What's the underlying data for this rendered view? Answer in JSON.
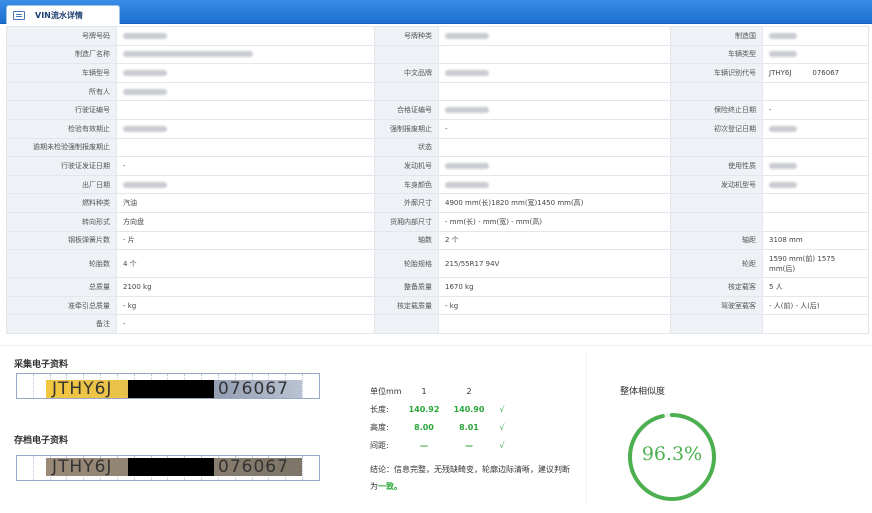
{
  "window": {
    "tab_title": "VIN流水详情",
    "tab_icon": "window-icon"
  },
  "rows": [
    [
      "号牌号码",
      "",
      "号牌种类",
      "",
      "制造国",
      ""
    ],
    [
      "制造厂名称",
      "",
      "",
      "",
      "车辆类型",
      ""
    ],
    [
      "车辆型号",
      "",
      "中文品牌",
      "",
      "车辆识别代号",
      "JTHY6J   076067"
    ],
    [
      "所有人",
      "",
      "",
      "",
      "",
      ""
    ],
    [
      "行驶证编号",
      "",
      "合格证编号",
      "",
      "保险终止日期",
      "-"
    ],
    [
      "检验有效期止",
      "",
      "强制报废期止",
      "-",
      "初次登记日期",
      ""
    ],
    [
      "逾期未检验强制报废期止",
      "",
      "状态",
      "",
      "",
      ""
    ],
    [
      "行驶证发证日期",
      "-",
      "发动机号",
      "",
      "使用性质",
      ""
    ],
    [
      "出厂日期",
      "",
      "车身颜色",
      "",
      "发动机型号",
      ""
    ],
    [
      "燃料种类",
      "汽油",
      "外廓尺寸",
      "4900 mm(长)1820 mm(宽)1450 mm(高)",
      "",
      ""
    ],
    [
      "转向形式",
      "方向盘",
      "货厢内部尺寸",
      "- mm(长) - mm(宽) - mm(高)",
      "",
      ""
    ],
    [
      "钢板弹簧片数",
      "- 片",
      "轴数",
      "2 个",
      "轴距",
      "3108 mm"
    ],
    [
      "轮胎数",
      "4 个",
      "轮胎规格",
      "215/55R17 94V",
      "轮距",
      "1590 mm(前) 1575 mm(后)"
    ],
    [
      "总质量",
      "2100 kg",
      "整备质量",
      "1670 kg",
      "核定载客",
      "5 人"
    ],
    [
      "准牵引总质量",
      "- kg",
      "核定载质量",
      "- kg",
      "驾驶室载客",
      "- 人(前) - 人(后)"
    ],
    [
      "备注",
      "-",
      "",
      "",
      "",
      ""
    ]
  ],
  "capture": {
    "title": "采集电子资料",
    "vin_prefix": "JTHY6J",
    "vin_suffix": "076067"
  },
  "archive": {
    "title": "存档电子资料",
    "vin_prefix": "JTHY6J",
    "vin_suffix": "076067"
  },
  "metrics": {
    "unit_label": "单位mm",
    "col1": "1",
    "col2": "2",
    "rows": [
      {
        "label": "长度:",
        "v1": "140.92",
        "v2": "140.90",
        "check": "√"
      },
      {
        "label": "高度:",
        "v1": "8.00",
        "v2": "8.01",
        "check": "√"
      },
      {
        "label": "间距:",
        "v1": "—",
        "v2": "—",
        "check": "√"
      }
    ],
    "conclusion_prefix": "结论：信息完整，无残缺畸变，轮廓边际清晰，建议判断为",
    "conclusion_result": "一致。"
  },
  "similarity": {
    "title": "整体相似度",
    "value_text": "96.3%",
    "value": 0.963,
    "color": "#4caf50"
  }
}
